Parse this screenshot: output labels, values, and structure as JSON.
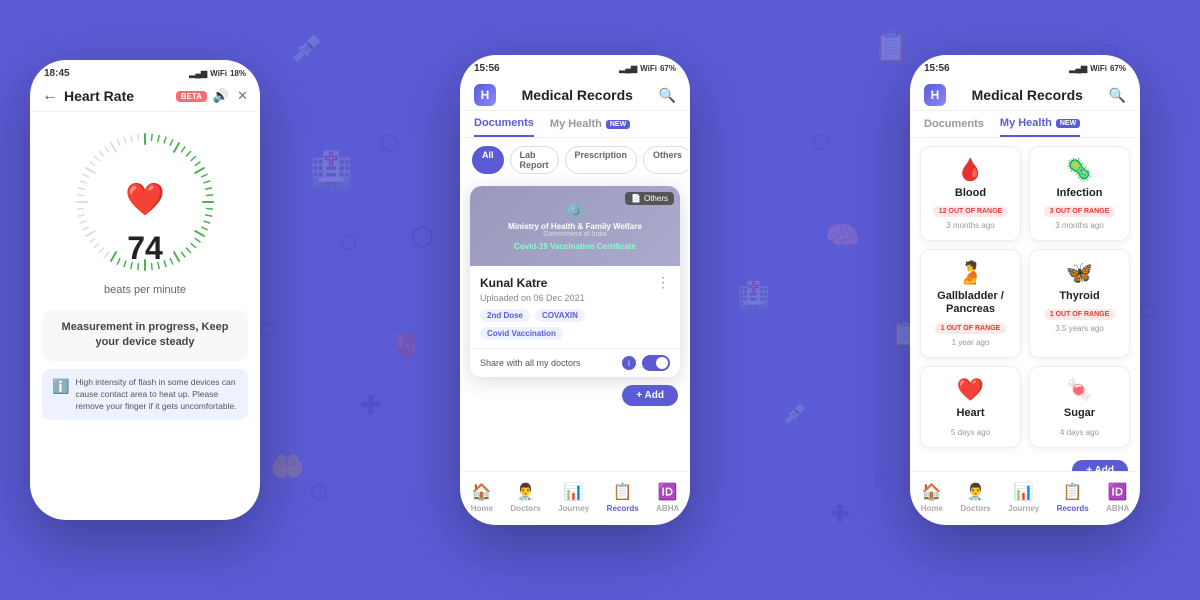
{
  "background_color": "#5B5BD6",
  "phone1": {
    "status_bar": {
      "time": "18:45",
      "battery": "18%"
    },
    "header": {
      "back_label": "←",
      "title": "Heart Rate",
      "beta_label": "BETA"
    },
    "heart_rate": {
      "value": "74",
      "unit": "beats per minute"
    },
    "measurement_msg": "Measurement in progress, Keep your device steady",
    "warning_text": "High intensity of flash in some devices can cause contact area to heat up. Please remove your finger if it gets uncomfortable."
  },
  "phone2": {
    "status_bar": {
      "time": "15:56",
      "battery": "67%"
    },
    "header": {
      "title": "Medical Records"
    },
    "tabs": [
      {
        "label": "Documents",
        "active": true
      },
      {
        "label": "My Health",
        "new": true,
        "active": false
      }
    ],
    "filters": [
      "All",
      "Lab Report",
      "Prescription",
      "Others"
    ],
    "active_filter": "All",
    "document": {
      "cert_title": "Covid-19 Vaccination Certificate",
      "gov_line1": "Ministry of Health & Family Welfare",
      "gov_line2": "Government of India",
      "tag": "Others",
      "name": "Kunal Katre",
      "uploaded": "Uploaded on 06 Dec 2021",
      "tags": [
        "2nd Dose",
        "COVAXIN",
        "Covid Vaccination"
      ],
      "share_label": "Share with all my doctors"
    },
    "add_btn": "+ Add"
  },
  "phone3": {
    "status_bar": {
      "time": "15:56",
      "battery": "67%"
    },
    "header": {
      "title": "Medical Records"
    },
    "tabs": [
      {
        "label": "Documents",
        "active": false
      },
      {
        "label": "My Health",
        "new": true,
        "active": true
      }
    ],
    "health_items": [
      {
        "icon": "🩸",
        "name": "Blood",
        "range": "12 OUT OF RANGE",
        "time": "3 months ago",
        "out": true
      },
      {
        "icon": "🦠",
        "name": "Infection",
        "range": "3 OUT OF RANGE",
        "time": "3 months ago",
        "out": true
      },
      {
        "icon": "🫄",
        "name": "Gallbladder / Pancreas",
        "range": "1 OUT OF RANGE",
        "time": "1 year ago",
        "out": true
      },
      {
        "icon": "🦋",
        "name": "Thyroid",
        "range": "1 OUT OF RANGE",
        "time": "3.5 years ago",
        "out": true
      },
      {
        "icon": "❤️",
        "name": "Heart",
        "range": null,
        "time": "5 days ago",
        "out": false
      },
      {
        "icon": "🍬",
        "name": "Sugar",
        "range": null,
        "time": "4 days ago",
        "out": false
      }
    ],
    "add_btn": "+ Add"
  },
  "nav_items": [
    {
      "icon": "🏠",
      "label": "Home"
    },
    {
      "icon": "👨‍⚕️",
      "label": "Doctors"
    },
    {
      "icon": "📊",
      "label": "Journey"
    },
    {
      "icon": "📋",
      "label": "Records"
    },
    {
      "icon": "🆔",
      "label": "ABHA"
    }
  ]
}
